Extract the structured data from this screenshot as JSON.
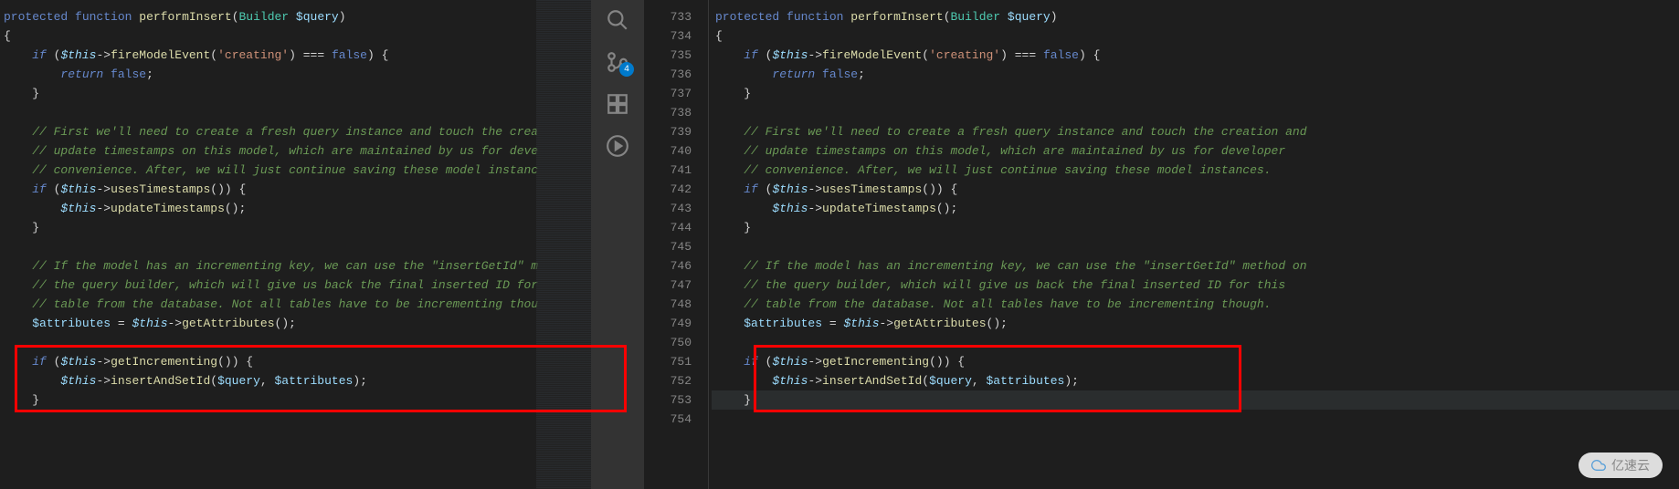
{
  "activity": {
    "search": "search-icon",
    "scm": "source-control-icon",
    "scm_badge": "4",
    "extensions": "extensions-icon",
    "run": "run-icon"
  },
  "gutter": {
    "start": 733,
    "end": 754
  },
  "code": {
    "left": {
      "lines": [
        {
          "t": "sig",
          "indent": 0,
          "parts": [
            {
              "c": "kw-vis",
              "v": "protected"
            },
            {
              "c": "",
              "v": " "
            },
            {
              "c": "kw-func",
              "v": "function"
            },
            {
              "c": "",
              "v": " "
            },
            {
              "c": "fn-name",
              "v": "performInsert"
            },
            {
              "c": "punct",
              "v": "("
            },
            {
              "c": "type",
              "v": "Builder"
            },
            {
              "c": "",
              "v": " "
            },
            {
              "c": "var-name",
              "v": "$query"
            },
            {
              "c": "punct",
              "v": ")"
            }
          ]
        },
        {
          "t": "brace",
          "indent": 0,
          "parts": [
            {
              "c": "punct",
              "v": "{"
            }
          ]
        },
        {
          "t": "if",
          "indent": 1,
          "parts": [
            {
              "c": "kw-ctrl",
              "v": "if"
            },
            {
              "c": "",
              "v": " ("
            },
            {
              "c": "var-this",
              "v": "$this"
            },
            {
              "c": "op",
              "v": "->"
            },
            {
              "c": "method",
              "v": "fireModelEvent"
            },
            {
              "c": "punct",
              "v": "("
            },
            {
              "c": "str",
              "v": "'creating'"
            },
            {
              "c": "punct",
              "v": ")"
            },
            {
              "c": "",
              "v": " "
            },
            {
              "c": "op",
              "v": "==="
            },
            {
              "c": "",
              "v": " "
            },
            {
              "c": "bool",
              "v": "false"
            },
            {
              "c": "punct",
              "v": ") {"
            }
          ]
        },
        {
          "t": "ret",
          "indent": 2,
          "parts": [
            {
              "c": "kw-ctrl",
              "v": "return"
            },
            {
              "c": "",
              "v": " "
            },
            {
              "c": "bool",
              "v": "false"
            },
            {
              "c": "punct",
              "v": ";"
            }
          ]
        },
        {
          "t": "brace",
          "indent": 1,
          "parts": [
            {
              "c": "punct",
              "v": "}"
            }
          ]
        },
        {
          "t": "blank",
          "indent": 0,
          "parts": []
        },
        {
          "t": "cmt",
          "indent": 1,
          "parts": [
            {
              "c": "comment",
              "v": "// First we'll need to create a fresh query instance and touch the crea"
            }
          ]
        },
        {
          "t": "cmt",
          "indent": 1,
          "parts": [
            {
              "c": "comment",
              "v": "// update timestamps on this model, which are maintained by us for deve"
            }
          ]
        },
        {
          "t": "cmt",
          "indent": 1,
          "parts": [
            {
              "c": "comment",
              "v": "// convenience. After, we will just continue saving these model instanc"
            }
          ]
        },
        {
          "t": "if",
          "indent": 1,
          "parts": [
            {
              "c": "kw-ctrl",
              "v": "if"
            },
            {
              "c": "",
              "v": " ("
            },
            {
              "c": "var-this",
              "v": "$this"
            },
            {
              "c": "op",
              "v": "->"
            },
            {
              "c": "method",
              "v": "usesTimestamps"
            },
            {
              "c": "punct",
              "v": "()) {"
            }
          ]
        },
        {
          "t": "call",
          "indent": 2,
          "parts": [
            {
              "c": "var-this",
              "v": "$this"
            },
            {
              "c": "op",
              "v": "->"
            },
            {
              "c": "method",
              "v": "updateTimestamps"
            },
            {
              "c": "punct",
              "v": "();"
            }
          ]
        },
        {
          "t": "brace",
          "indent": 1,
          "parts": [
            {
              "c": "punct",
              "v": "}"
            }
          ]
        },
        {
          "t": "blank",
          "indent": 0,
          "parts": []
        },
        {
          "t": "cmt",
          "indent": 1,
          "parts": [
            {
              "c": "comment",
              "v": "// If the model has an incrementing key, we can use the \"insertGetId\" m"
            }
          ]
        },
        {
          "t": "cmt",
          "indent": 1,
          "parts": [
            {
              "c": "comment",
              "v": "// the query builder, which will give us back the final inserted ID for"
            }
          ]
        },
        {
          "t": "cmt",
          "indent": 1,
          "parts": [
            {
              "c": "comment",
              "v": "// table from the database. Not all tables have to be incrementing thou"
            }
          ]
        },
        {
          "t": "assign",
          "indent": 1,
          "parts": [
            {
              "c": "var-name",
              "v": "$attributes"
            },
            {
              "c": "",
              "v": " "
            },
            {
              "c": "op",
              "v": "="
            },
            {
              "c": "",
              "v": " "
            },
            {
              "c": "var-this",
              "v": "$this"
            },
            {
              "c": "op",
              "v": "->"
            },
            {
              "c": "method",
              "v": "getAttributes"
            },
            {
              "c": "punct",
              "v": "();"
            }
          ]
        },
        {
          "t": "blank",
          "indent": 0,
          "parts": []
        },
        {
          "t": "if",
          "indent": 1,
          "parts": [
            {
              "c": "kw-ctrl",
              "v": "if"
            },
            {
              "c": "",
              "v": " ("
            },
            {
              "c": "var-this",
              "v": "$this"
            },
            {
              "c": "op",
              "v": "->"
            },
            {
              "c": "method",
              "v": "getIncrementing"
            },
            {
              "c": "punct",
              "v": "()) {"
            }
          ]
        },
        {
          "t": "call",
          "indent": 2,
          "parts": [
            {
              "c": "var-this",
              "v": "$this"
            },
            {
              "c": "op",
              "v": "->"
            },
            {
              "c": "method",
              "v": "insertAndSetId"
            },
            {
              "c": "punct",
              "v": "("
            },
            {
              "c": "var-name",
              "v": "$query"
            },
            {
              "c": "punct",
              "v": ", "
            },
            {
              "c": "var-name",
              "v": "$attributes"
            },
            {
              "c": "punct",
              "v": ");"
            }
          ]
        },
        {
          "t": "brace",
          "indent": 1,
          "parts": [
            {
              "c": "punct",
              "v": "}"
            }
          ]
        },
        {
          "t": "blank",
          "indent": 0,
          "parts": []
        }
      ]
    },
    "right": {
      "lines": [
        {
          "t": "sig",
          "indent": 0,
          "parts": [
            {
              "c": "kw-vis",
              "v": "protected"
            },
            {
              "c": "",
              "v": " "
            },
            {
              "c": "kw-func",
              "v": "function"
            },
            {
              "c": "",
              "v": " "
            },
            {
              "c": "fn-name",
              "v": "performInsert"
            },
            {
              "c": "punct",
              "v": "("
            },
            {
              "c": "type",
              "v": "Builder"
            },
            {
              "c": "",
              "v": " "
            },
            {
              "c": "var-name",
              "v": "$query"
            },
            {
              "c": "punct",
              "v": ")"
            }
          ]
        },
        {
          "t": "brace",
          "indent": 0,
          "parts": [
            {
              "c": "punct",
              "v": "{"
            }
          ]
        },
        {
          "t": "if",
          "indent": 1,
          "parts": [
            {
              "c": "kw-ctrl",
              "v": "if"
            },
            {
              "c": "",
              "v": " ("
            },
            {
              "c": "var-this",
              "v": "$this"
            },
            {
              "c": "op",
              "v": "->"
            },
            {
              "c": "method",
              "v": "fireModelEvent"
            },
            {
              "c": "punct",
              "v": "("
            },
            {
              "c": "str",
              "v": "'creating'"
            },
            {
              "c": "punct",
              "v": ")"
            },
            {
              "c": "",
              "v": " "
            },
            {
              "c": "op",
              "v": "==="
            },
            {
              "c": "",
              "v": " "
            },
            {
              "c": "bool",
              "v": "false"
            },
            {
              "c": "punct",
              "v": ") {"
            }
          ]
        },
        {
          "t": "ret",
          "indent": 2,
          "parts": [
            {
              "c": "kw-ctrl",
              "v": "return"
            },
            {
              "c": "",
              "v": " "
            },
            {
              "c": "bool",
              "v": "false"
            },
            {
              "c": "punct",
              "v": ";"
            }
          ]
        },
        {
          "t": "brace",
          "indent": 1,
          "parts": [
            {
              "c": "punct",
              "v": "}"
            }
          ]
        },
        {
          "t": "blank",
          "indent": 0,
          "parts": []
        },
        {
          "t": "cmt",
          "indent": 1,
          "parts": [
            {
              "c": "comment",
              "v": "// First we'll need to create a fresh query instance and touch the creation and"
            }
          ]
        },
        {
          "t": "cmt",
          "indent": 1,
          "parts": [
            {
              "c": "comment",
              "v": "// update timestamps on this model, which are maintained by us for developer"
            }
          ]
        },
        {
          "t": "cmt",
          "indent": 1,
          "parts": [
            {
              "c": "comment",
              "v": "// convenience. After, we will just continue saving these model instances."
            }
          ]
        },
        {
          "t": "if",
          "indent": 1,
          "parts": [
            {
              "c": "kw-ctrl",
              "v": "if"
            },
            {
              "c": "",
              "v": " ("
            },
            {
              "c": "var-this",
              "v": "$this"
            },
            {
              "c": "op",
              "v": "->"
            },
            {
              "c": "method",
              "v": "usesTimestamps"
            },
            {
              "c": "punct",
              "v": "()) {"
            }
          ]
        },
        {
          "t": "call",
          "indent": 2,
          "parts": [
            {
              "c": "var-this",
              "v": "$this"
            },
            {
              "c": "op",
              "v": "->"
            },
            {
              "c": "method",
              "v": "updateTimestamps"
            },
            {
              "c": "punct",
              "v": "();"
            }
          ]
        },
        {
          "t": "brace",
          "indent": 1,
          "parts": [
            {
              "c": "punct",
              "v": "}"
            }
          ]
        },
        {
          "t": "blank",
          "indent": 0,
          "parts": []
        },
        {
          "t": "cmt",
          "indent": 1,
          "parts": [
            {
              "c": "comment",
              "v": "// If the model has an incrementing key, we can use the \"insertGetId\" method on"
            }
          ]
        },
        {
          "t": "cmt",
          "indent": 1,
          "parts": [
            {
              "c": "comment",
              "v": "// the query builder, which will give us back the final inserted ID for this"
            }
          ]
        },
        {
          "t": "cmt",
          "indent": 1,
          "parts": [
            {
              "c": "comment",
              "v": "// table from the database. Not all tables have to be incrementing though."
            }
          ]
        },
        {
          "t": "assign",
          "indent": 1,
          "parts": [
            {
              "c": "var-name",
              "v": "$attributes"
            },
            {
              "c": "",
              "v": " "
            },
            {
              "c": "op",
              "v": "="
            },
            {
              "c": "",
              "v": " "
            },
            {
              "c": "var-this",
              "v": "$this"
            },
            {
              "c": "op",
              "v": "->"
            },
            {
              "c": "method",
              "v": "getAttributes"
            },
            {
              "c": "punct",
              "v": "();"
            }
          ]
        },
        {
          "t": "blank",
          "indent": 0,
          "parts": []
        },
        {
          "t": "if",
          "indent": 1,
          "parts": [
            {
              "c": "kw-ctrl",
              "v": "if"
            },
            {
              "c": "",
              "v": " ("
            },
            {
              "c": "var-this",
              "v": "$this"
            },
            {
              "c": "op",
              "v": "->"
            },
            {
              "c": "method",
              "v": "getIncrementing"
            },
            {
              "c": "punct",
              "v": "()) {"
            }
          ]
        },
        {
          "t": "call",
          "indent": 2,
          "parts": [
            {
              "c": "var-this",
              "v": "$this"
            },
            {
              "c": "op",
              "v": "->"
            },
            {
              "c": "method",
              "v": "insertAndSetId"
            },
            {
              "c": "punct",
              "v": "("
            },
            {
              "c": "var-name",
              "v": "$query"
            },
            {
              "c": "punct",
              "v": ", "
            },
            {
              "c": "var-name",
              "v": "$attributes"
            },
            {
              "c": "punct",
              "v": ");"
            }
          ]
        },
        {
          "t": "brace",
          "indent": 1,
          "cursor": true,
          "parts": [
            {
              "c": "punct",
              "v": "}"
            }
          ]
        },
        {
          "t": "blank",
          "indent": 0,
          "parts": []
        }
      ]
    }
  },
  "watermark": {
    "text": "亿速云"
  }
}
